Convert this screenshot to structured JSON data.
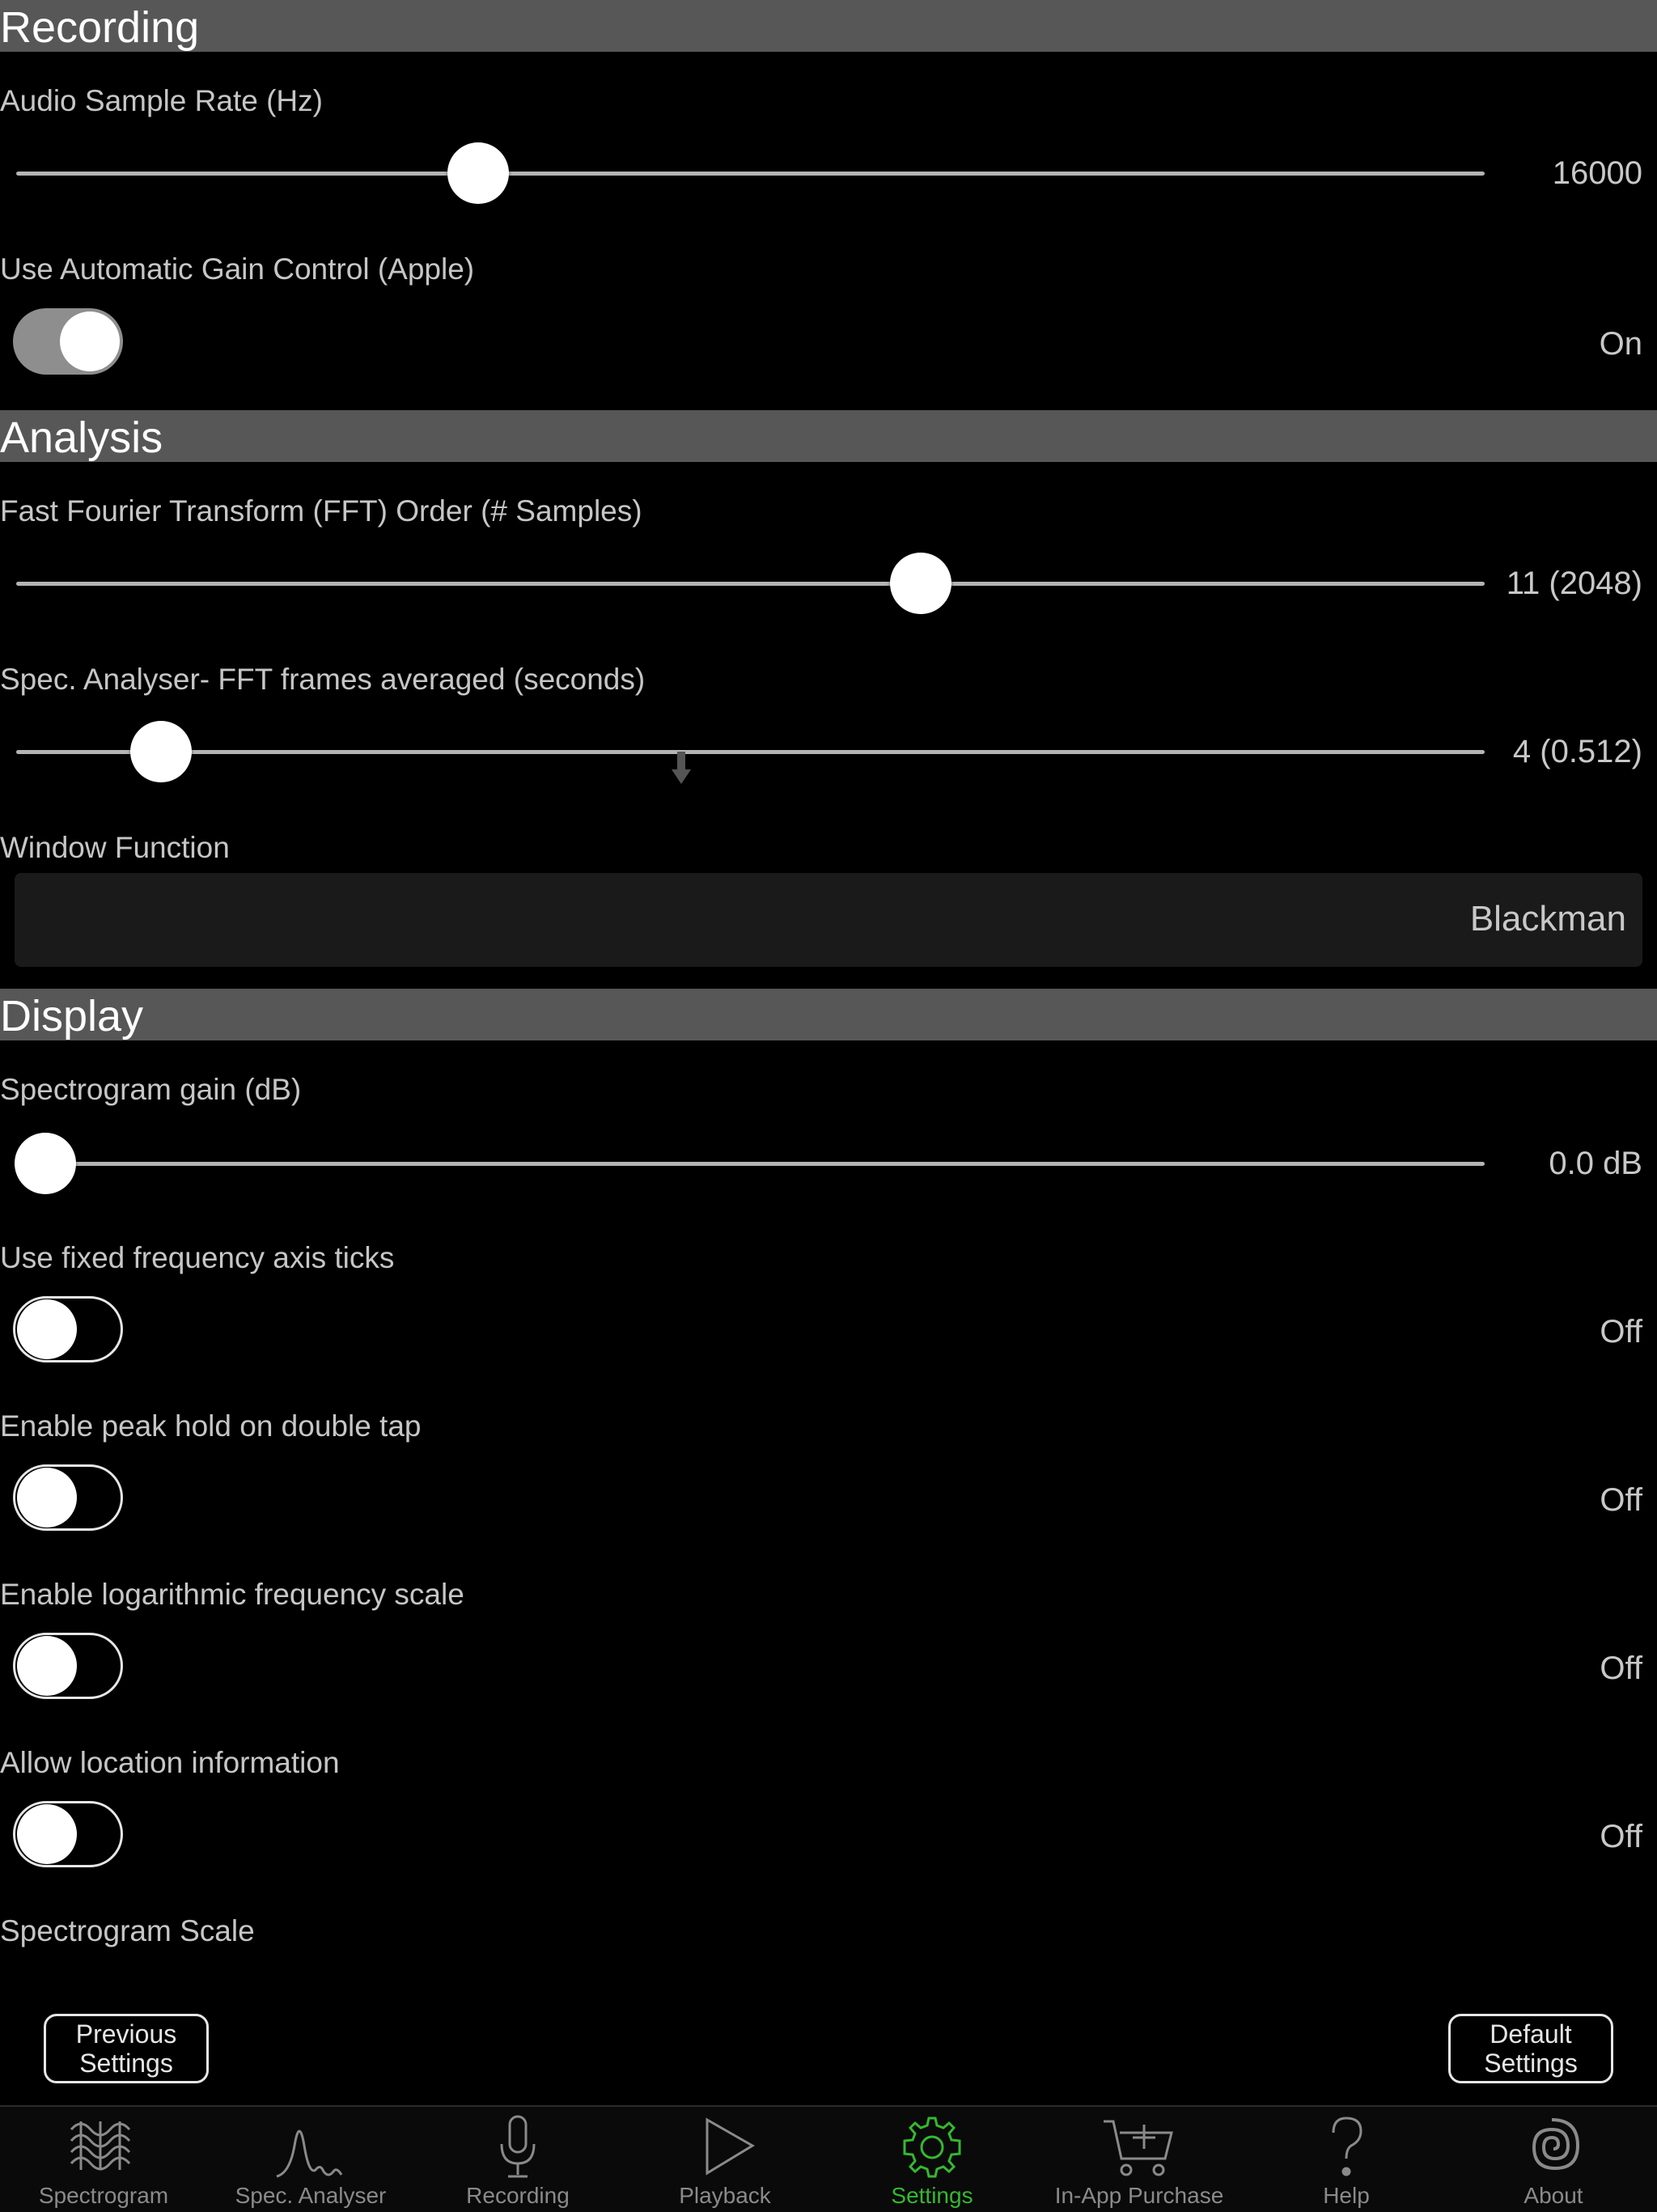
{
  "sections": {
    "recording": "Recording",
    "analysis": "Analysis",
    "display": "Display"
  },
  "settings": {
    "sample_rate": {
      "label": "Audio Sample Rate (Hz)",
      "value": "16000",
      "position": 0.295
    },
    "agc": {
      "label": "Use Automatic Gain Control (Apple)",
      "value": "On",
      "state": true
    },
    "fft_order": {
      "label": "Fast Fourier Transform (FFT) Order (# Samples)",
      "value": "11 (2048)",
      "position": 0.596
    },
    "fft_frames": {
      "label": "Spec. Analyser- FFT frames averaged (seconds)",
      "value": "4 (0.512)",
      "position": 0.079
    },
    "window_function": {
      "label": "Window Function",
      "value": "Blackman"
    },
    "spectrogram_gain": {
      "label": "Spectrogram gain (dB)",
      "value": "0.0 dB",
      "position": 0.0
    },
    "fixed_ticks": {
      "label": "Use fixed frequency axis ticks",
      "value": "Off",
      "state": false
    },
    "peak_hold": {
      "label": "Enable peak hold on double tap",
      "value": "Off",
      "state": false
    },
    "log_scale": {
      "label": "Enable logarithmic frequency scale",
      "value": "Off",
      "state": false
    },
    "location": {
      "label": "Allow location information",
      "value": "Off",
      "state": false
    },
    "spectrogram_scale": {
      "label": "Spectrogram Scale"
    }
  },
  "buttons": {
    "previous": {
      "line1": "Previous",
      "line2": "Settings"
    },
    "default": {
      "line1": "Default",
      "line2": "Settings"
    }
  },
  "tabs": [
    {
      "label": "Spectrogram",
      "icon": "spectrogram-wave-icon"
    },
    {
      "label": "Spec. Analyser",
      "icon": "spectrum-peak-icon"
    },
    {
      "label": "Recording",
      "icon": "microphone-icon"
    },
    {
      "label": "Playback",
      "icon": "play-icon"
    },
    {
      "label": "Settings",
      "icon": "gear-icon",
      "active": true
    },
    {
      "label": "In-App Purchase",
      "icon": "cart-icon"
    },
    {
      "label": "Help",
      "icon": "question-icon"
    },
    {
      "label": "About",
      "icon": "spiral-icon"
    }
  ],
  "colors": {
    "background": "#000000",
    "section_header": "#575757",
    "active_tab": "#35b830",
    "inactive_tab": "#8a8a8a"
  }
}
